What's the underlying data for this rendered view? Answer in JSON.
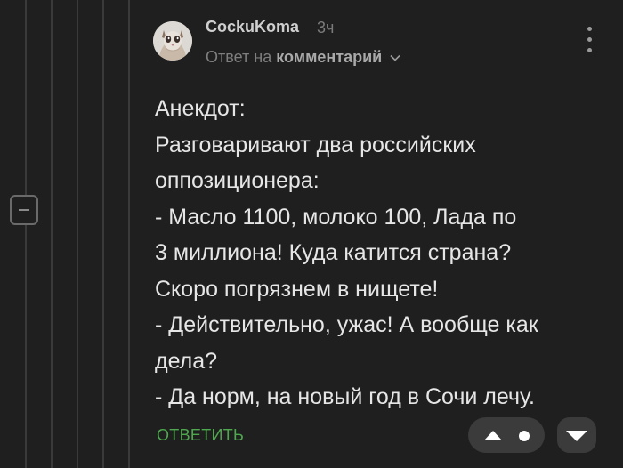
{
  "comment": {
    "username": "CockuKoma",
    "timestamp": "3ч",
    "reply_prefix": "Ответ на",
    "reply_link": "комментарий",
    "body_lines": [
      "Анекдот:",
      "Разговаривают два российских",
      "оппозиционера:",
      "- Масло 1100, молоко 100, Лада по",
      "3 миллиона! Куда катится страна?",
      "Скоро погрязнем в нищете!",
      "- Действительно, ужас! А вообще как",
      "дела?",
      "- Да норм, на новый год в Сочи лечу."
    ],
    "reply_button": "ОТВЕТИТЬ"
  },
  "icons": {
    "more": "vertical-dots-icon",
    "collapse": "minus-icon",
    "chevron": "chevron-down-icon",
    "upvote": "triangle-up-icon",
    "downvote": "triangle-down-icon"
  },
  "colors": {
    "background": "#1f1f1f",
    "text": "#e6e6e6",
    "muted": "#7e7e7e",
    "accent_green": "#4ea84e",
    "button_bg": "#3b3b3b"
  }
}
